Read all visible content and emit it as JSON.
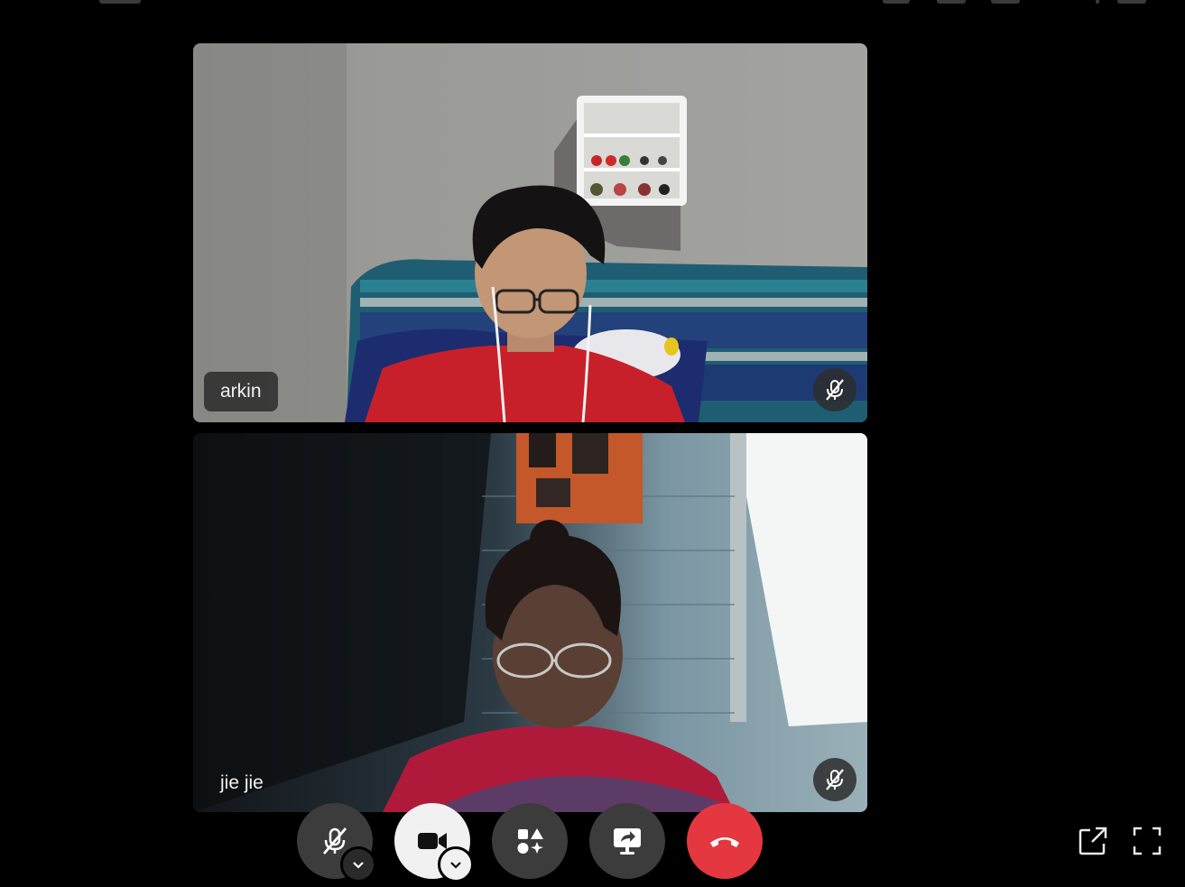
{
  "window": {
    "background": "#000000"
  },
  "participants": [
    {
      "name": "arkin",
      "muted": true,
      "shirt_color": "#c8202a",
      "wall_color": "#8f8f8c"
    },
    {
      "name": "jie jie",
      "muted": true,
      "shirt_color": "#b01a3a",
      "wall_color": "#6e8a96"
    }
  ],
  "controls": {
    "mic": {
      "icon": "mic-off-icon",
      "state": "muted"
    },
    "camera": {
      "icon": "video-camera-icon",
      "state": "on"
    },
    "effects": {
      "icon": "effects-shapes-icon"
    },
    "share": {
      "icon": "screen-share-icon"
    },
    "end_call": {
      "icon": "phone-hangup-icon",
      "color": "#e5373f"
    }
  },
  "corner_actions": [
    {
      "icon": "pop-out-icon"
    },
    {
      "icon": "fullscreen-icon"
    }
  ],
  "colors": {
    "tile_label_bg": "#2a2a2a",
    "control_bg": "#3c3c3c",
    "control_light_bg": "#f1f1f1",
    "end_call": "#e5373f"
  }
}
